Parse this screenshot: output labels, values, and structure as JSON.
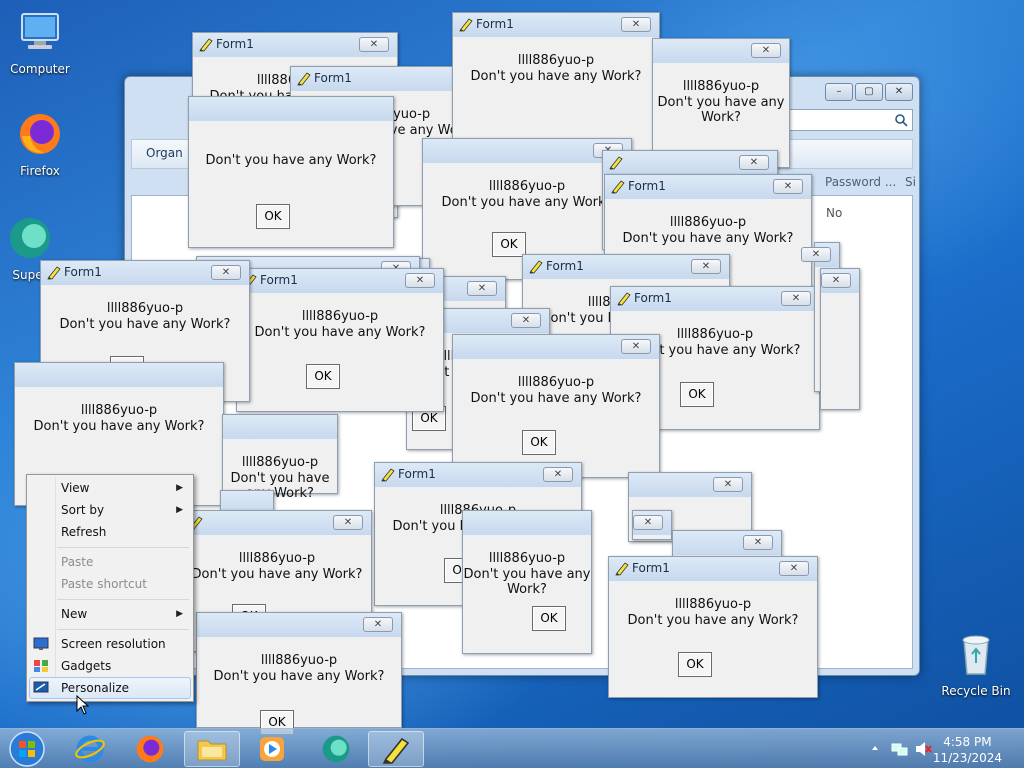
{
  "desktop": {
    "icons": [
      {
        "label": "Computer"
      },
      {
        "label": "Firefox"
      },
      {
        "label": "Super"
      },
      {
        "label": "Recycle Bin"
      }
    ]
  },
  "explorer": {
    "toolbar_organize": "Organ",
    "col_password": "Password ...",
    "col_si": "Si",
    "cell_no": "No"
  },
  "dialog": {
    "title": "Form1",
    "line1": "llll886yuo-p",
    "line2": "Don't you have any Work?",
    "ok": "OK",
    "close": "✕"
  },
  "context_menu": {
    "items": [
      {
        "label": "View",
        "arrow": "▶"
      },
      {
        "label": "Sort by",
        "arrow": "▶"
      },
      {
        "label": "Refresh"
      },
      {
        "label": "Paste"
      },
      {
        "label": "Paste shortcut"
      },
      {
        "label": "New",
        "arrow": "▶"
      },
      {
        "label": "Screen resolution"
      },
      {
        "label": "Gadgets"
      },
      {
        "label": "Personalize"
      }
    ]
  },
  "taskbar": {
    "time": "4:58 PM",
    "date": "11/23/2024"
  },
  "colors": {
    "accent": "#1d5fb8",
    "titlebar": "#c7d9ee"
  }
}
